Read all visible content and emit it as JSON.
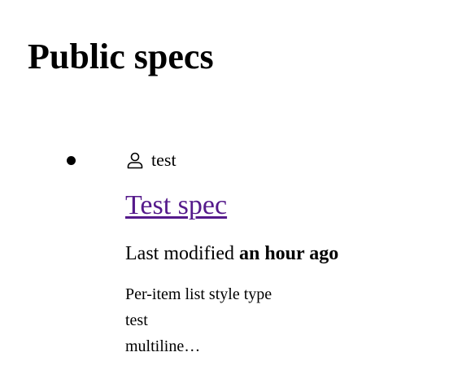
{
  "page": {
    "title": "Public specs"
  },
  "specs": [
    {
      "author": "test",
      "author_icon": "user-icon",
      "title": "Test spec",
      "link_color": "#551a8b",
      "modified_prefix": "Last modified",
      "modified_value": "an hour ago",
      "description_lines": [
        "Per-item list style type",
        "test",
        "multiline…"
      ]
    }
  ]
}
